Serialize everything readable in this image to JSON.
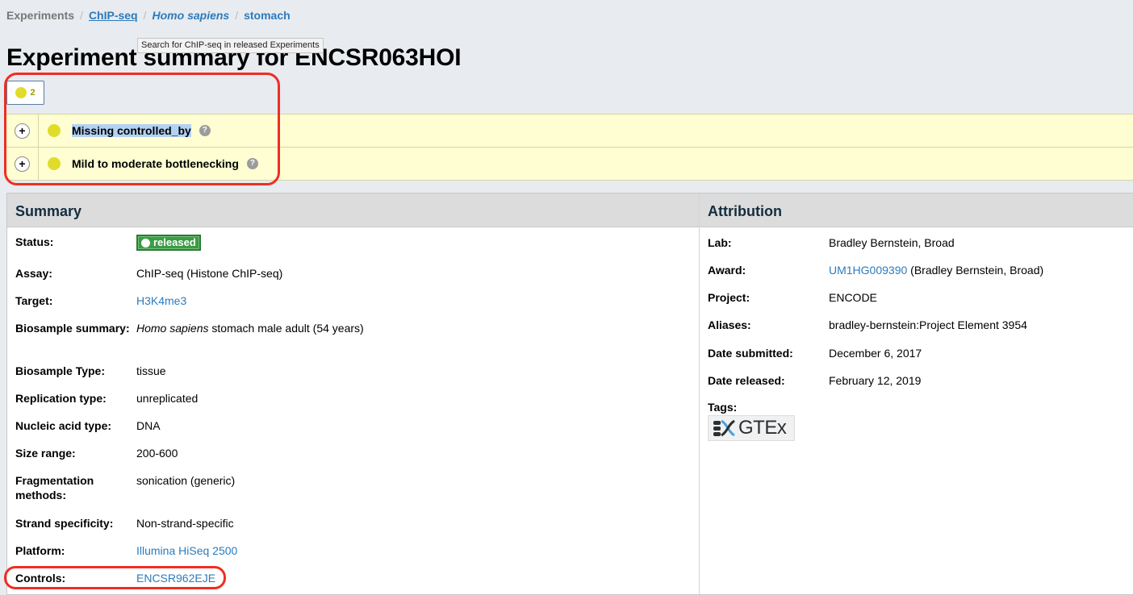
{
  "breadcrumb": {
    "root": "Experiments",
    "assay": "ChIP-seq",
    "organism": "Homo sapiens",
    "organ": "stomach",
    "separator": "/"
  },
  "tooltip": "Search for ChIP-seq in released Experiments",
  "page_title": "Experiment summary for ENCSR063HOI",
  "audit": {
    "count": "2",
    "color": "#e0dc2c",
    "items": [
      {
        "label": "Missing controlled_by",
        "selected": true
      },
      {
        "label": "Mild to moderate bottlenecking",
        "selected": false
      }
    ],
    "expand_glyph": "+",
    "help_glyph": "?"
  },
  "summary": {
    "heading": "Summary",
    "status_label": "Status:",
    "status_value": "released",
    "status_color": "#3b9b46",
    "assay_label": "Assay:",
    "assay_value": "ChIP-seq (Histone ChIP-seq)",
    "target_label": "Target:",
    "target_value": "H3K4me3",
    "biosample_summary_label": "Biosample summary:",
    "biosample_summary_organism": "Homo sapiens",
    "biosample_summary_rest": "stomach male adult (54 years)",
    "biosample_type_label": "Biosample Type:",
    "biosample_type_value": "tissue",
    "replication_label": "Replication type:",
    "replication_value": "unreplicated",
    "nucleic_label": "Nucleic acid type:",
    "nucleic_value": "DNA",
    "size_label": "Size range:",
    "size_value": "200-600",
    "fragmentation_label": "Fragmentation methods:",
    "fragmentation_value": "sonication (generic)",
    "strand_label": "Strand specificity:",
    "strand_value": "Non-strand-specific",
    "platform_label": "Platform:",
    "platform_value": "Illumina HiSeq 2500",
    "controls_label": "Controls:",
    "controls_value": "ENCSR962EJE"
  },
  "attribution": {
    "heading": "Attribution",
    "lab_label": "Lab:",
    "lab_value": "Bradley Bernstein, Broad",
    "award_label": "Award:",
    "award_link": "UM1HG009390",
    "award_rest": "(Bradley Bernstein, Broad)",
    "project_label": "Project:",
    "project_value": "ENCODE",
    "aliases_label": "Aliases:",
    "aliases_value": "bradley-bernstein:Project Element 3954",
    "submitted_label": "Date submitted:",
    "submitted_value": "December 6, 2017",
    "released_label": "Date released:",
    "released_value": "February 12, 2019",
    "tags_label": "Tags:",
    "tag_logo_text": "GTEx",
    "tag_logo_icon": "gtex-dna-icon"
  }
}
